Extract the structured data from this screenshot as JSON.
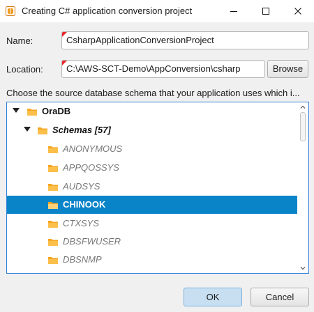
{
  "window": {
    "title": "Creating C# application conversion project",
    "app_icon": "aws-sct-app-icon",
    "controls": [
      "minimize-icon",
      "maximize-icon",
      "close-icon"
    ]
  },
  "form": {
    "name_label": "Name:",
    "name_value": "CsharpApplicationConversionProject",
    "location_label": "Location:",
    "location_value": "C:\\AWS-SCT-Demo\\AppConversion\\csharp",
    "browse_label": "Browse",
    "prompt": "Choose the source database schema that your application uses which i..."
  },
  "tree": {
    "root": {
      "label": "OraDB",
      "expanded": true,
      "icon": "database-folder-icon"
    },
    "schemas": {
      "label": "Schemas [57]",
      "expanded": true,
      "icon": "folder-icon"
    },
    "items": [
      {
        "label": "ANONYMOUS",
        "selected": false
      },
      {
        "label": "APPQOSSYS",
        "selected": false
      },
      {
        "label": "AUDSYS",
        "selected": false
      },
      {
        "label": "CHINOOK",
        "selected": true
      },
      {
        "label": "CTXSYS",
        "selected": false
      },
      {
        "label": "DBSFWUSER",
        "selected": false
      },
      {
        "label": "DBSNMP",
        "selected": false
      }
    ]
  },
  "buttons": {
    "ok_label": "OK",
    "cancel_label": "Cancel"
  },
  "colors": {
    "selection": "#0a84c9",
    "folder": "#f5a623",
    "required_marker": "#e8262b",
    "tree_border": "#2f7ed8",
    "ok_button": "#c7dff1"
  }
}
